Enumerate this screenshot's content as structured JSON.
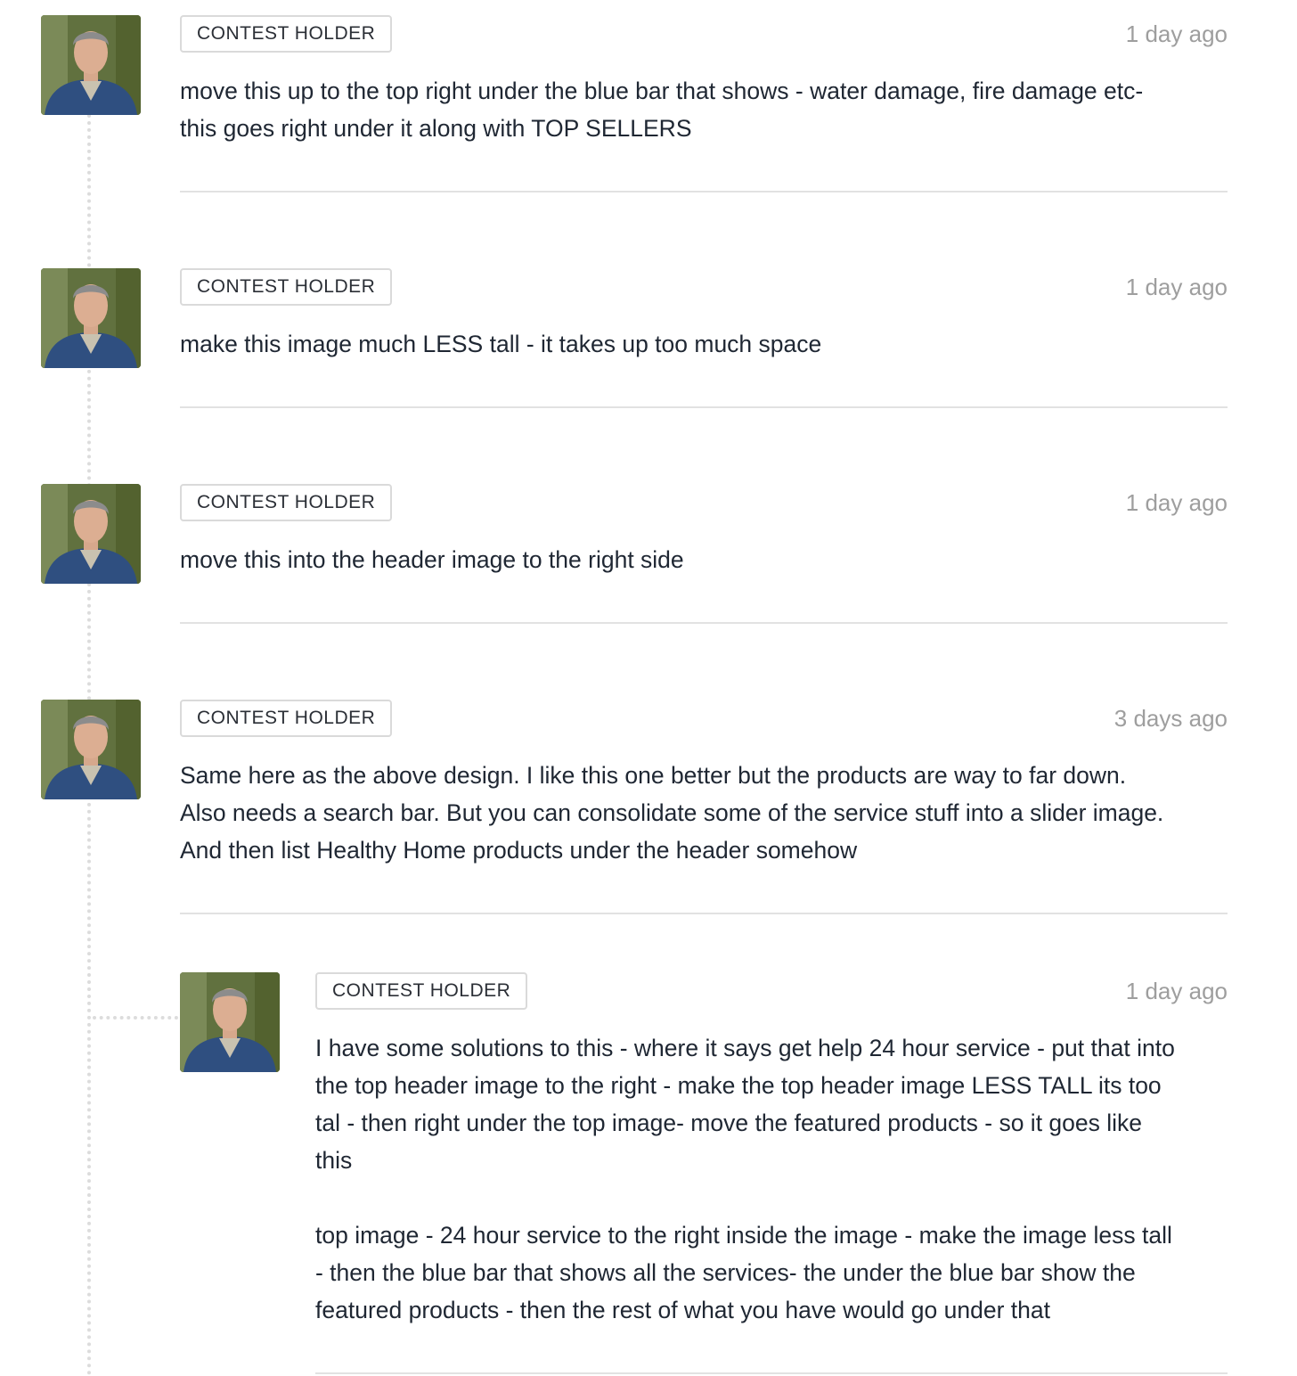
{
  "comments": [
    {
      "badge": "CONTEST HOLDER",
      "time": "1 day ago",
      "text": "move this up to the top right under the blue bar that shows - water damage, fire damage etc-\nthis goes right under it along with TOP SELLERS"
    },
    {
      "badge": "CONTEST HOLDER",
      "time": "1 day ago",
      "text": "make this image much LESS tall - it takes up too much space"
    },
    {
      "badge": "CONTEST HOLDER",
      "time": "1 day ago",
      "text": "move this into the header image to the right side"
    },
    {
      "badge": "CONTEST HOLDER",
      "time": "3 days ago",
      "text": "Same here as the above design. I like this one better but the products are way to far down.\nAlso needs a search bar. But you can consolidate some of the service stuff into a slider image.\nAnd then list Healthy Home products under the header somehow"
    }
  ],
  "reply": {
    "badge": "CONTEST HOLDER",
    "time": "1 day ago",
    "text": "I have some solutions to this - where it says get help 24 hour service - put that into\nthe top header image to the right - make the top header image LESS TALL its too\ntal - then right under the top image- move the featured products - so it goes like\nthis\n\ntop image - 24 hour service to the right inside the image - make the image less tall\n- then the blue bar that shows all the services- the under the blue bar show the\nfeatured products - then the rest of what you have would go under that"
  }
}
